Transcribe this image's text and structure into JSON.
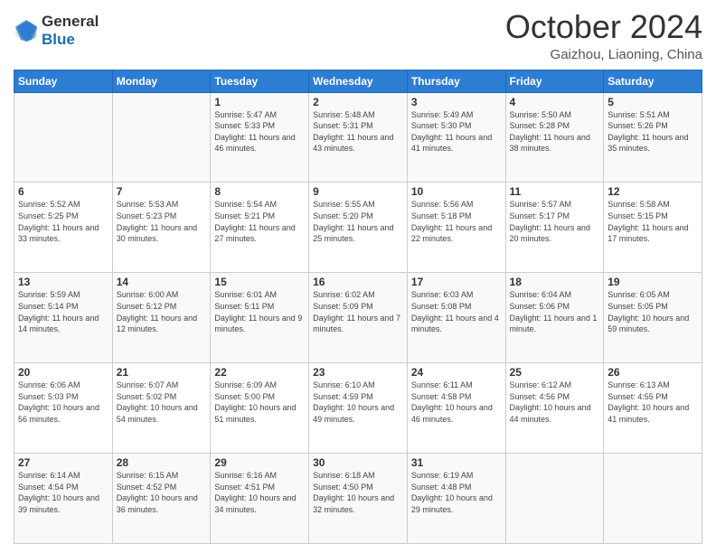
{
  "header": {
    "logo": {
      "line1": "General",
      "line2": "Blue"
    },
    "title": "October 2024",
    "location": "Gaizhou, Liaoning, China"
  },
  "weekdays": [
    "Sunday",
    "Monday",
    "Tuesday",
    "Wednesday",
    "Thursday",
    "Friday",
    "Saturday"
  ],
  "weeks": [
    [
      {
        "day": "",
        "sunrise": "",
        "sunset": "",
        "daylight": ""
      },
      {
        "day": "",
        "sunrise": "",
        "sunset": "",
        "daylight": ""
      },
      {
        "day": "1",
        "sunrise": "Sunrise: 5:47 AM",
        "sunset": "Sunset: 5:33 PM",
        "daylight": "Daylight: 11 hours and 46 minutes."
      },
      {
        "day": "2",
        "sunrise": "Sunrise: 5:48 AM",
        "sunset": "Sunset: 5:31 PM",
        "daylight": "Daylight: 11 hours and 43 minutes."
      },
      {
        "day": "3",
        "sunrise": "Sunrise: 5:49 AM",
        "sunset": "Sunset: 5:30 PM",
        "daylight": "Daylight: 11 hours and 41 minutes."
      },
      {
        "day": "4",
        "sunrise": "Sunrise: 5:50 AM",
        "sunset": "Sunset: 5:28 PM",
        "daylight": "Daylight: 11 hours and 38 minutes."
      },
      {
        "day": "5",
        "sunrise": "Sunrise: 5:51 AM",
        "sunset": "Sunset: 5:26 PM",
        "daylight": "Daylight: 11 hours and 35 minutes."
      }
    ],
    [
      {
        "day": "6",
        "sunrise": "Sunrise: 5:52 AM",
        "sunset": "Sunset: 5:25 PM",
        "daylight": "Daylight: 11 hours and 33 minutes."
      },
      {
        "day": "7",
        "sunrise": "Sunrise: 5:53 AM",
        "sunset": "Sunset: 5:23 PM",
        "daylight": "Daylight: 11 hours and 30 minutes."
      },
      {
        "day": "8",
        "sunrise": "Sunrise: 5:54 AM",
        "sunset": "Sunset: 5:21 PM",
        "daylight": "Daylight: 11 hours and 27 minutes."
      },
      {
        "day": "9",
        "sunrise": "Sunrise: 5:55 AM",
        "sunset": "Sunset: 5:20 PM",
        "daylight": "Daylight: 11 hours and 25 minutes."
      },
      {
        "day": "10",
        "sunrise": "Sunrise: 5:56 AM",
        "sunset": "Sunset: 5:18 PM",
        "daylight": "Daylight: 11 hours and 22 minutes."
      },
      {
        "day": "11",
        "sunrise": "Sunrise: 5:57 AM",
        "sunset": "Sunset: 5:17 PM",
        "daylight": "Daylight: 11 hours and 20 minutes."
      },
      {
        "day": "12",
        "sunrise": "Sunrise: 5:58 AM",
        "sunset": "Sunset: 5:15 PM",
        "daylight": "Daylight: 11 hours and 17 minutes."
      }
    ],
    [
      {
        "day": "13",
        "sunrise": "Sunrise: 5:59 AM",
        "sunset": "Sunset: 5:14 PM",
        "daylight": "Daylight: 11 hours and 14 minutes."
      },
      {
        "day": "14",
        "sunrise": "Sunrise: 6:00 AM",
        "sunset": "Sunset: 5:12 PM",
        "daylight": "Daylight: 11 hours and 12 minutes."
      },
      {
        "day": "15",
        "sunrise": "Sunrise: 6:01 AM",
        "sunset": "Sunset: 5:11 PM",
        "daylight": "Daylight: 11 hours and 9 minutes."
      },
      {
        "day": "16",
        "sunrise": "Sunrise: 6:02 AM",
        "sunset": "Sunset: 5:09 PM",
        "daylight": "Daylight: 11 hours and 7 minutes."
      },
      {
        "day": "17",
        "sunrise": "Sunrise: 6:03 AM",
        "sunset": "Sunset: 5:08 PM",
        "daylight": "Daylight: 11 hours and 4 minutes."
      },
      {
        "day": "18",
        "sunrise": "Sunrise: 6:04 AM",
        "sunset": "Sunset: 5:06 PM",
        "daylight": "Daylight: 11 hours and 1 minute."
      },
      {
        "day": "19",
        "sunrise": "Sunrise: 6:05 AM",
        "sunset": "Sunset: 5:05 PM",
        "daylight": "Daylight: 10 hours and 59 minutes."
      }
    ],
    [
      {
        "day": "20",
        "sunrise": "Sunrise: 6:06 AM",
        "sunset": "Sunset: 5:03 PM",
        "daylight": "Daylight: 10 hours and 56 minutes."
      },
      {
        "day": "21",
        "sunrise": "Sunrise: 6:07 AM",
        "sunset": "Sunset: 5:02 PM",
        "daylight": "Daylight: 10 hours and 54 minutes."
      },
      {
        "day": "22",
        "sunrise": "Sunrise: 6:09 AM",
        "sunset": "Sunset: 5:00 PM",
        "daylight": "Daylight: 10 hours and 51 minutes."
      },
      {
        "day": "23",
        "sunrise": "Sunrise: 6:10 AM",
        "sunset": "Sunset: 4:59 PM",
        "daylight": "Daylight: 10 hours and 49 minutes."
      },
      {
        "day": "24",
        "sunrise": "Sunrise: 6:11 AM",
        "sunset": "Sunset: 4:58 PM",
        "daylight": "Daylight: 10 hours and 46 minutes."
      },
      {
        "day": "25",
        "sunrise": "Sunrise: 6:12 AM",
        "sunset": "Sunset: 4:56 PM",
        "daylight": "Daylight: 10 hours and 44 minutes."
      },
      {
        "day": "26",
        "sunrise": "Sunrise: 6:13 AM",
        "sunset": "Sunset: 4:55 PM",
        "daylight": "Daylight: 10 hours and 41 minutes."
      }
    ],
    [
      {
        "day": "27",
        "sunrise": "Sunrise: 6:14 AM",
        "sunset": "Sunset: 4:54 PM",
        "daylight": "Daylight: 10 hours and 39 minutes."
      },
      {
        "day": "28",
        "sunrise": "Sunrise: 6:15 AM",
        "sunset": "Sunset: 4:52 PM",
        "daylight": "Daylight: 10 hours and 36 minutes."
      },
      {
        "day": "29",
        "sunrise": "Sunrise: 6:16 AM",
        "sunset": "Sunset: 4:51 PM",
        "daylight": "Daylight: 10 hours and 34 minutes."
      },
      {
        "day": "30",
        "sunrise": "Sunrise: 6:18 AM",
        "sunset": "Sunset: 4:50 PM",
        "daylight": "Daylight: 10 hours and 32 minutes."
      },
      {
        "day": "31",
        "sunrise": "Sunrise: 6:19 AM",
        "sunset": "Sunset: 4:48 PM",
        "daylight": "Daylight: 10 hours and 29 minutes."
      },
      {
        "day": "",
        "sunrise": "",
        "sunset": "",
        "daylight": ""
      },
      {
        "day": "",
        "sunrise": "",
        "sunset": "",
        "daylight": ""
      }
    ]
  ]
}
